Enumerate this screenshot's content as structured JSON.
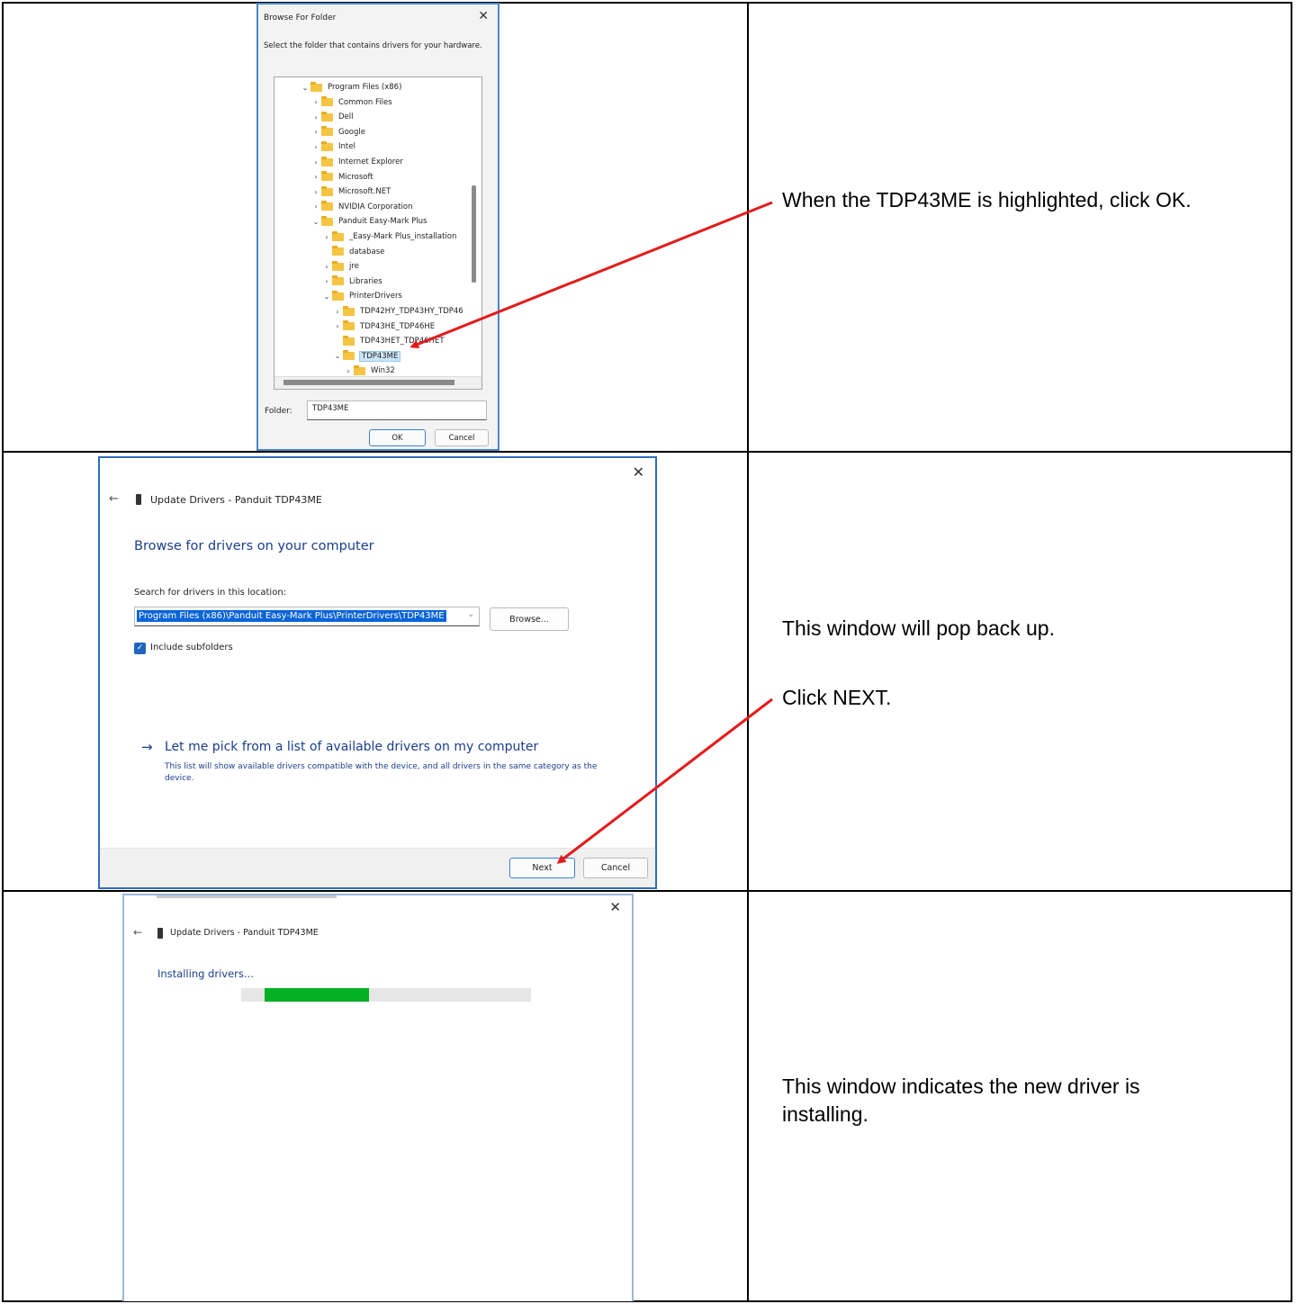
{
  "instructions": {
    "step1": "When the TDP43ME is highlighted, click OK.",
    "step2_line1": "This window will pop back up.",
    "step2_line2": "Click NEXT.",
    "step3": "This window indicates the new driver is installing."
  },
  "browse_dialog": {
    "title": "Browse For Folder",
    "close": "✕",
    "description": "Select the folder that contains drivers for your hardware.",
    "tree": [
      {
        "chevron": "⌄",
        "label": "Program Files (x86)",
        "level": 0
      },
      {
        "chevron": "›",
        "label": "Common Files",
        "level": 1
      },
      {
        "chevron": "›",
        "label": "Dell",
        "level": 1
      },
      {
        "chevron": "›",
        "label": "Google",
        "level": 1
      },
      {
        "chevron": "›",
        "label": "Intel",
        "level": 1
      },
      {
        "chevron": "›",
        "label": "Internet Explorer",
        "level": 1
      },
      {
        "chevron": "›",
        "label": "Microsoft",
        "level": 1
      },
      {
        "chevron": "›",
        "label": "Microsoft.NET",
        "level": 1
      },
      {
        "chevron": "›",
        "label": "NVIDIA Corporation",
        "level": 1
      },
      {
        "chevron": "⌄",
        "label": "Panduit Easy-Mark Plus",
        "level": 1
      },
      {
        "chevron": "›",
        "label": "_Easy-Mark Plus_installation",
        "level": 2
      },
      {
        "chevron": "",
        "label": "database",
        "level": 2
      },
      {
        "chevron": "›",
        "label": "jre",
        "level": 2
      },
      {
        "chevron": "›",
        "label": "Libraries",
        "level": 2
      },
      {
        "chevron": "⌄",
        "label": "PrinterDrivers",
        "level": 2
      },
      {
        "chevron": "›",
        "label": "TDP42HY_TDP43HY_TDP46",
        "level": 3
      },
      {
        "chevron": "›",
        "label": "TDP43HE_TDP46HE",
        "level": 3
      },
      {
        "chevron": "",
        "label": "TDP43HET_TDP46HET",
        "level": 3
      },
      {
        "chevron": "⌄",
        "label": "TDP43ME",
        "level": 3,
        "selected": true
      },
      {
        "chevron": "›",
        "label": "Win32",
        "level": 4
      }
    ],
    "folder_label": "Folder:",
    "folder_value": "TDP43ME",
    "ok_label": "OK",
    "cancel_label": "Cancel"
  },
  "update_dialog": {
    "close": "✕",
    "back": "←",
    "title": "Update Drivers - Panduit  TDP43ME",
    "heading": "Browse for drivers on your computer",
    "search_label": "Search for drivers in this location:",
    "path_value": "Program Files (x86)\\Panduit Easy-Mark Plus\\PrinterDrivers\\TDP43ME",
    "dropdown": "⌄",
    "browse_label": "Browse...",
    "checkbox_mark": "✓",
    "include_subfolders": "Include subfolders",
    "link_arrow": "→",
    "link_text": "Let me pick from a list of available drivers on my computer",
    "link_desc": "This list will show available drivers compatible with the device, and all drivers in the same category as the device.",
    "next_label": "Next",
    "cancel_label": "Cancel"
  },
  "installing_dialog": {
    "close": "✕",
    "back": "←",
    "title": "Update Drivers - Panduit  TDP43ME",
    "heading": "Installing drivers...",
    "progress_start": 0.08,
    "progress_end": 0.44
  },
  "colors": {
    "arrow": "#e31b1b",
    "progress_fill": "#06b025",
    "link_blue": "#1a3e8c",
    "selection_blue": "#0a64d8"
  }
}
